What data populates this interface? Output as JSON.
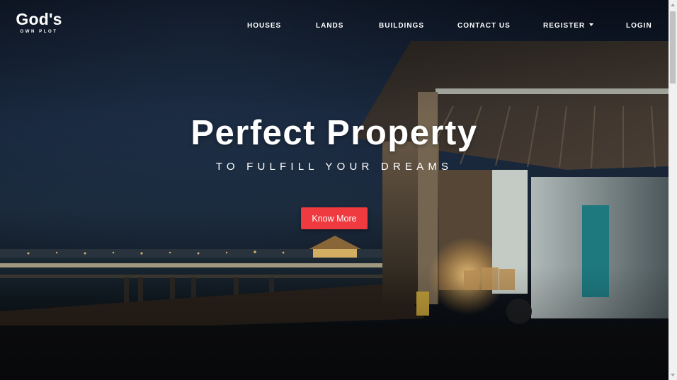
{
  "brand": {
    "title": "God's",
    "subtitle": "OWN PLOT"
  },
  "nav": {
    "houses": "HOUSES",
    "lands": "LANDS",
    "buildings": "BUILDINGS",
    "contact": "CONTACT US",
    "register": "REGISTER",
    "login": "LOGIN"
  },
  "hero": {
    "headline": "Perfect Property",
    "tagline": "TO FULFILL YOUR DREAMS",
    "cta_label": "Know More"
  },
  "colors": {
    "cta": "#ef3a3f",
    "text": "#ffffff",
    "night_sky": "#17263b"
  },
  "background": {
    "subject": "night-waterfront-villa-photo"
  }
}
